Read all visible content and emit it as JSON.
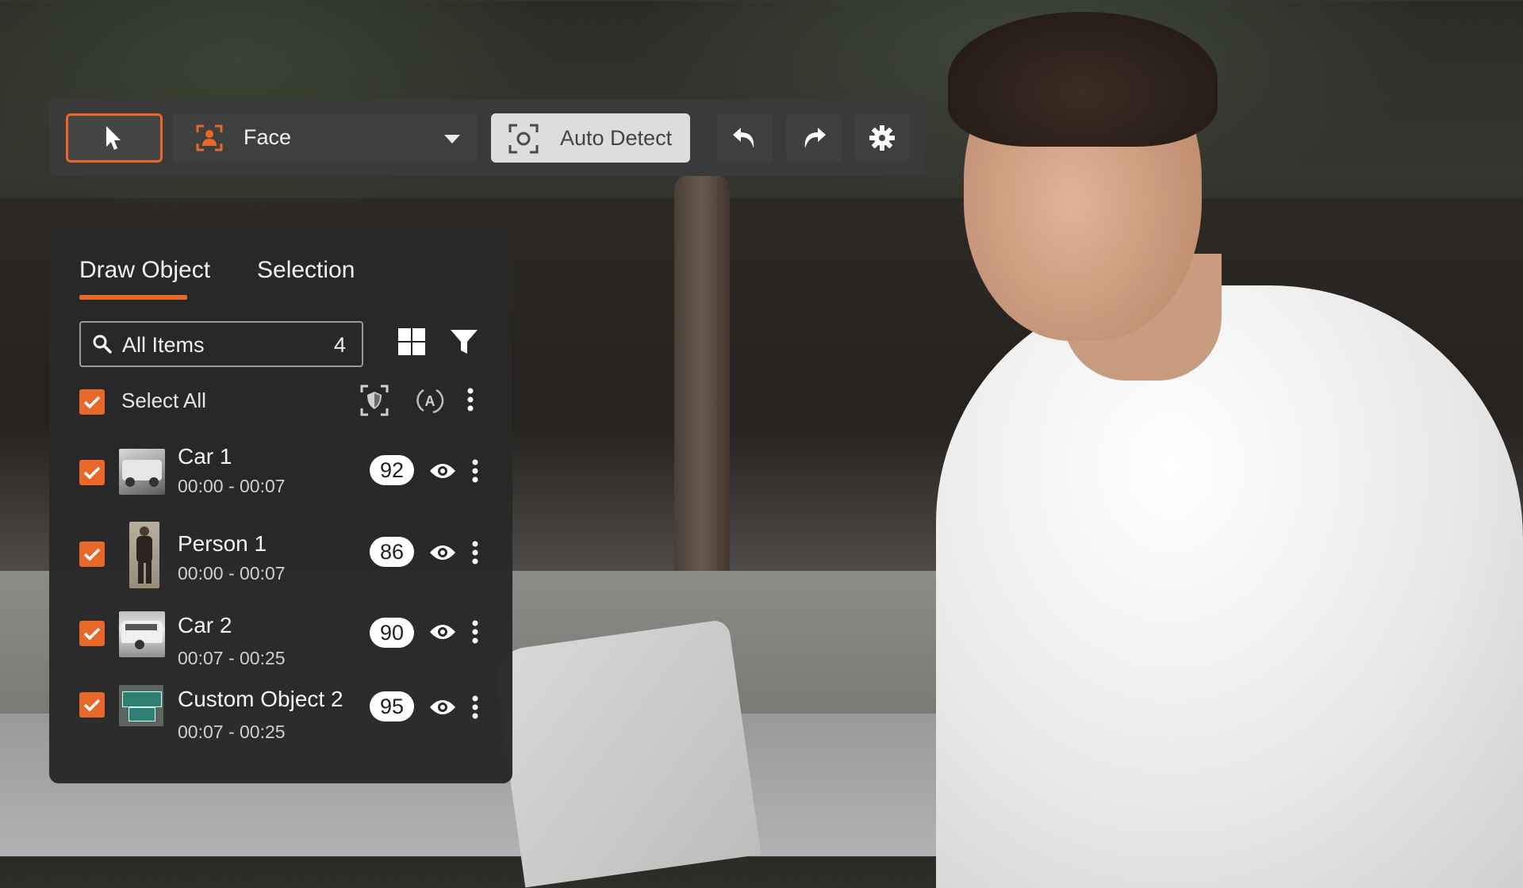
{
  "toolbar": {
    "pointer_tool": "pointer-icon",
    "object_type": {
      "selected": "Face",
      "icon": "face-frame-icon"
    },
    "auto_detect_label": "Auto Detect",
    "undo": "undo-icon",
    "redo": "redo-icon",
    "settings": "gear-icon",
    "accent_color": "#e8682a"
  },
  "panel": {
    "tabs": [
      {
        "label": "Draw Object",
        "active": true
      },
      {
        "label": "Selection",
        "active": false
      }
    ],
    "search": {
      "label": "All Items",
      "count": "4"
    },
    "select_all_label": "Select All",
    "select_all_checked": true,
    "items": [
      {
        "name": "Car 1",
        "time": "00:00 - 00:07",
        "score": "92",
        "checked": true,
        "thumb": "car"
      },
      {
        "name": "Person 1",
        "time": "00:00 - 00:07",
        "score": "86",
        "checked": true,
        "thumb": "person"
      },
      {
        "name": "Car 2",
        "time": "00:07 - 00:25",
        "score": "90",
        "checked": true,
        "thumb": "van"
      },
      {
        "name": "Custom Object 2",
        "time": "00:07 - 00:25",
        "score": "95",
        "checked": true,
        "thumb": "sign"
      }
    ]
  }
}
